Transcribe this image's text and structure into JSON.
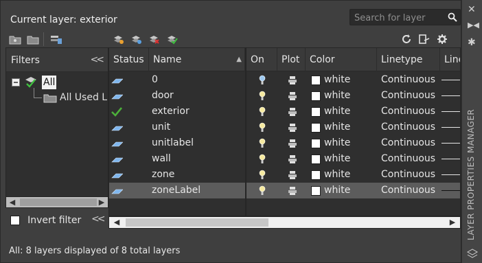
{
  "header": {
    "current_layer_label": "Current layer: exterior",
    "search_placeholder": "Search for layer"
  },
  "filters": {
    "title": "Filters",
    "tree_all": "All",
    "tree_all_used": "All Used L",
    "invert_filter_label": "Invert filter"
  },
  "columns": {
    "status": "Status",
    "name": "Name",
    "on": "On",
    "plot": "Plot",
    "color": "Color",
    "linetype": "Linetype",
    "lineweight_partial": "Line"
  },
  "layers": [
    {
      "name": "0",
      "status": "layer",
      "on_icon": "bulb-on-blue",
      "color": "white",
      "linetype": "Continuous"
    },
    {
      "name": "door",
      "status": "layer",
      "on_icon": "bulb-on",
      "color": "white",
      "linetype": "Continuous"
    },
    {
      "name": "exterior",
      "status": "current",
      "on_icon": "bulb-on",
      "color": "white",
      "linetype": "Continuous"
    },
    {
      "name": "unit",
      "status": "layer",
      "on_icon": "bulb-on",
      "color": "white",
      "linetype": "Continuous"
    },
    {
      "name": "unitlabel",
      "status": "layer",
      "on_icon": "bulb-on",
      "color": "white",
      "linetype": "Continuous"
    },
    {
      "name": "wall",
      "status": "layer",
      "on_icon": "bulb-on",
      "color": "white",
      "linetype": "Continuous"
    },
    {
      "name": "zone",
      "status": "layer",
      "on_icon": "bulb-on",
      "color": "white",
      "linetype": "Continuous"
    },
    {
      "name": "zoneLabel",
      "status": "layer",
      "on_icon": "bulb-on",
      "color": "white",
      "linetype": "Continuous",
      "selected": true
    }
  ],
  "status_bar": {
    "text": "All: 8 layers displayed of 8 total layers"
  },
  "side_strip": {
    "title": "LAYER PROPERTIES MANAGER"
  },
  "colors": {
    "panel_bg": "#3f3f3f",
    "grid_bg": "#2f2f2f",
    "header_bg": "#3a3a3a",
    "selected_row": "#5c5c5c",
    "layer_icon_blue": "#7fb6ee",
    "current_check_green": "#4caf3a"
  }
}
